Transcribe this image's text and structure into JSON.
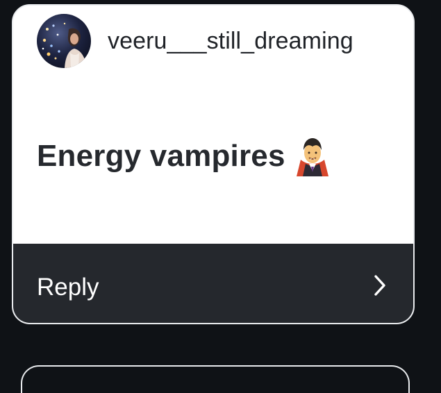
{
  "comment": {
    "username": "veeru___still_dreaming",
    "message": "Energy vampires",
    "avatar_icon": "profile-photo",
    "emoji_icon": "vampire-emoji"
  },
  "reply": {
    "label": "Reply",
    "icon": "chevron-right-icon"
  },
  "colors": {
    "background": "#0f1216",
    "card_border": "#e9ebee",
    "card_body": "#ffffff",
    "reply_bar": "#25282d",
    "username_text": "#1f2227",
    "message_text": "#26292e",
    "reply_text": "#ffffff"
  }
}
